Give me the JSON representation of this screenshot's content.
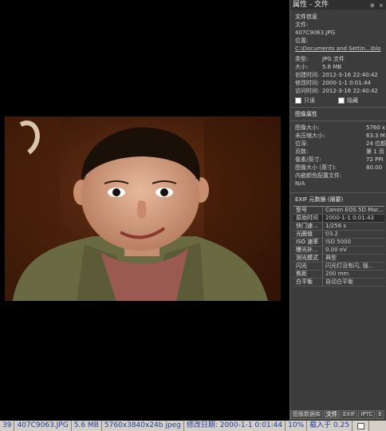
{
  "panel": {
    "title": "属性 - 文件",
    "title_buttons": [
      "⊕",
      "×"
    ],
    "file_info_header": "文件信息",
    "file_label": "文件:",
    "file_name": "407C9063.JPG",
    "location_label": "位置:",
    "location_value": "C:\\Documents and Settin...\\blo",
    "type_label": "类型:",
    "type_value": "JPG 文件",
    "size_label": "大小:",
    "size_value": "5.6 MB",
    "created_label": "创建时间:",
    "created_value": "2012-3-16 22:40:42",
    "modified_label": "修改时间:",
    "modified_value": "2000-1-1 0:01:44",
    "accessed_label": "访问时间:",
    "accessed_value": "2012-3-16 22:40:42",
    "readonly_label": "只读",
    "hidden_label": "隐藏",
    "image_props_header": "图像属性",
    "img_size_label": "图像大小:",
    "img_size_value": "5760 x",
    "uncompressed_label": "未压缩大小:",
    "uncompressed_value": "63.3 M",
    "depth_label": "位深:",
    "depth_value": "24 位颜",
    "pages_label": "页数:",
    "pages_value": "第 1 页",
    "ppi_label": "像素/英寸:",
    "ppi_value": "72 PPI",
    "img_size_in_label": "图像大小 (英寸):",
    "img_size_in_value": "80.00",
    "embedded_profile_label": "内嵌颜色配置文件:",
    "embedded_profile_value": "N/A",
    "exif_header": "EXIF 元数据 (摘要)",
    "exif": [
      {
        "k": "型号",
        "v": "Canon EOS 5D Mar..."
      },
      {
        "k": "原始时间",
        "v": "2000-1-1 0:01:43"
      },
      {
        "k": "快门速...",
        "v": "1/256 s"
      },
      {
        "k": "光圈值",
        "v": "f/3.2"
      },
      {
        "k": "ISO 速率",
        "v": "ISO 5000"
      },
      {
        "k": "曝光补...",
        "v": "0.00 eV"
      },
      {
        "k": "测光模式",
        "v": "典型"
      },
      {
        "k": "闪光",
        "v": "闪光灯没有闪, 强..."
      },
      {
        "k": "焦距",
        "v": "200 mm"
      },
      {
        "k": "白平衡",
        "v": "自动白平衡"
      }
    ],
    "tabs": [
      "图像数据库",
      "文件",
      "EXIF",
      "IPTC",
      "E"
    ]
  },
  "status": {
    "index": "39",
    "filename": "407C9063.JPG",
    "filesize": "5.6 MB",
    "dimensions": "5760x3840x24b jpeg",
    "modified": "修改日期: 2000-1-1 0:01:44",
    "zoom": "10%",
    "loading": "载入于 0.25"
  }
}
